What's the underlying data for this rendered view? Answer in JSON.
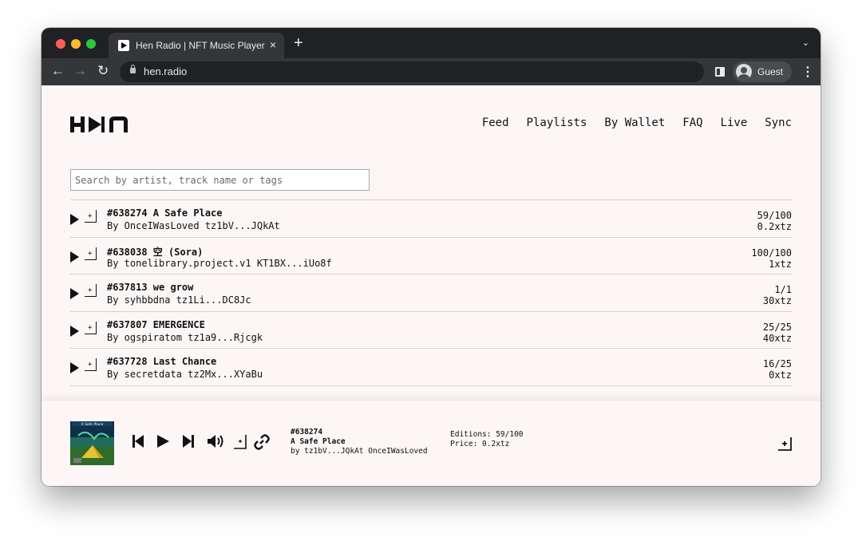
{
  "browser": {
    "tab_title": "Hen Radio | NFT Music Player",
    "tab_close": "×",
    "new_tab": "+",
    "tab_menu": "⌄",
    "url": "hen.radio",
    "profile": "Guest",
    "back": "←",
    "forward": "→",
    "reload": "↻",
    "menu": "⋮"
  },
  "nav": {
    "feed": "Feed",
    "playlists": "Playlists",
    "by_wallet": "By Wallet",
    "faq": "FAQ",
    "live": "Live",
    "sync": "Sync"
  },
  "search": {
    "placeholder": "Search by artist, track name or tags"
  },
  "tracks": [
    {
      "title": "#638274 A Safe Place",
      "by": "By OnceIWasLoved tz1bV...JQkAt",
      "editions": "59/100",
      "price": "0.2xtz"
    },
    {
      "title": "#638038 空 (Sora)",
      "by": "By tonelibrary.project.v1 KT1BX...iUo8f",
      "editions": "100/100",
      "price": "1xtz"
    },
    {
      "title": "#637813 we grow",
      "by": "By syhbbdna tz1Li...DC8Jc",
      "editions": "1/1",
      "price": "30xtz"
    },
    {
      "title": "#637807 EMERGENCE",
      "by": "By ogspiratom tz1a9...Rjcgk",
      "editions": "25/25",
      "price": "40xtz"
    },
    {
      "title": "#637728 Last Chance",
      "by": "By secretdata tz2Mx...XYaBu",
      "editions": "16/25",
      "price": "0xtz"
    }
  ],
  "add_glyph": "+",
  "player": {
    "id": "#638274",
    "title": "A Safe Place",
    "by": "by tz1bV...JQkAt OnceIWasLoved",
    "editions": "Editions: 59/100",
    "price": "Price: 0.2xtz",
    "cover_label": "A Safe Place"
  },
  "colors": {
    "page_bg": "#fcf7f6",
    "text": "#111111",
    "chrome_dark": "#202124",
    "chrome_toolbar": "#35363a"
  }
}
